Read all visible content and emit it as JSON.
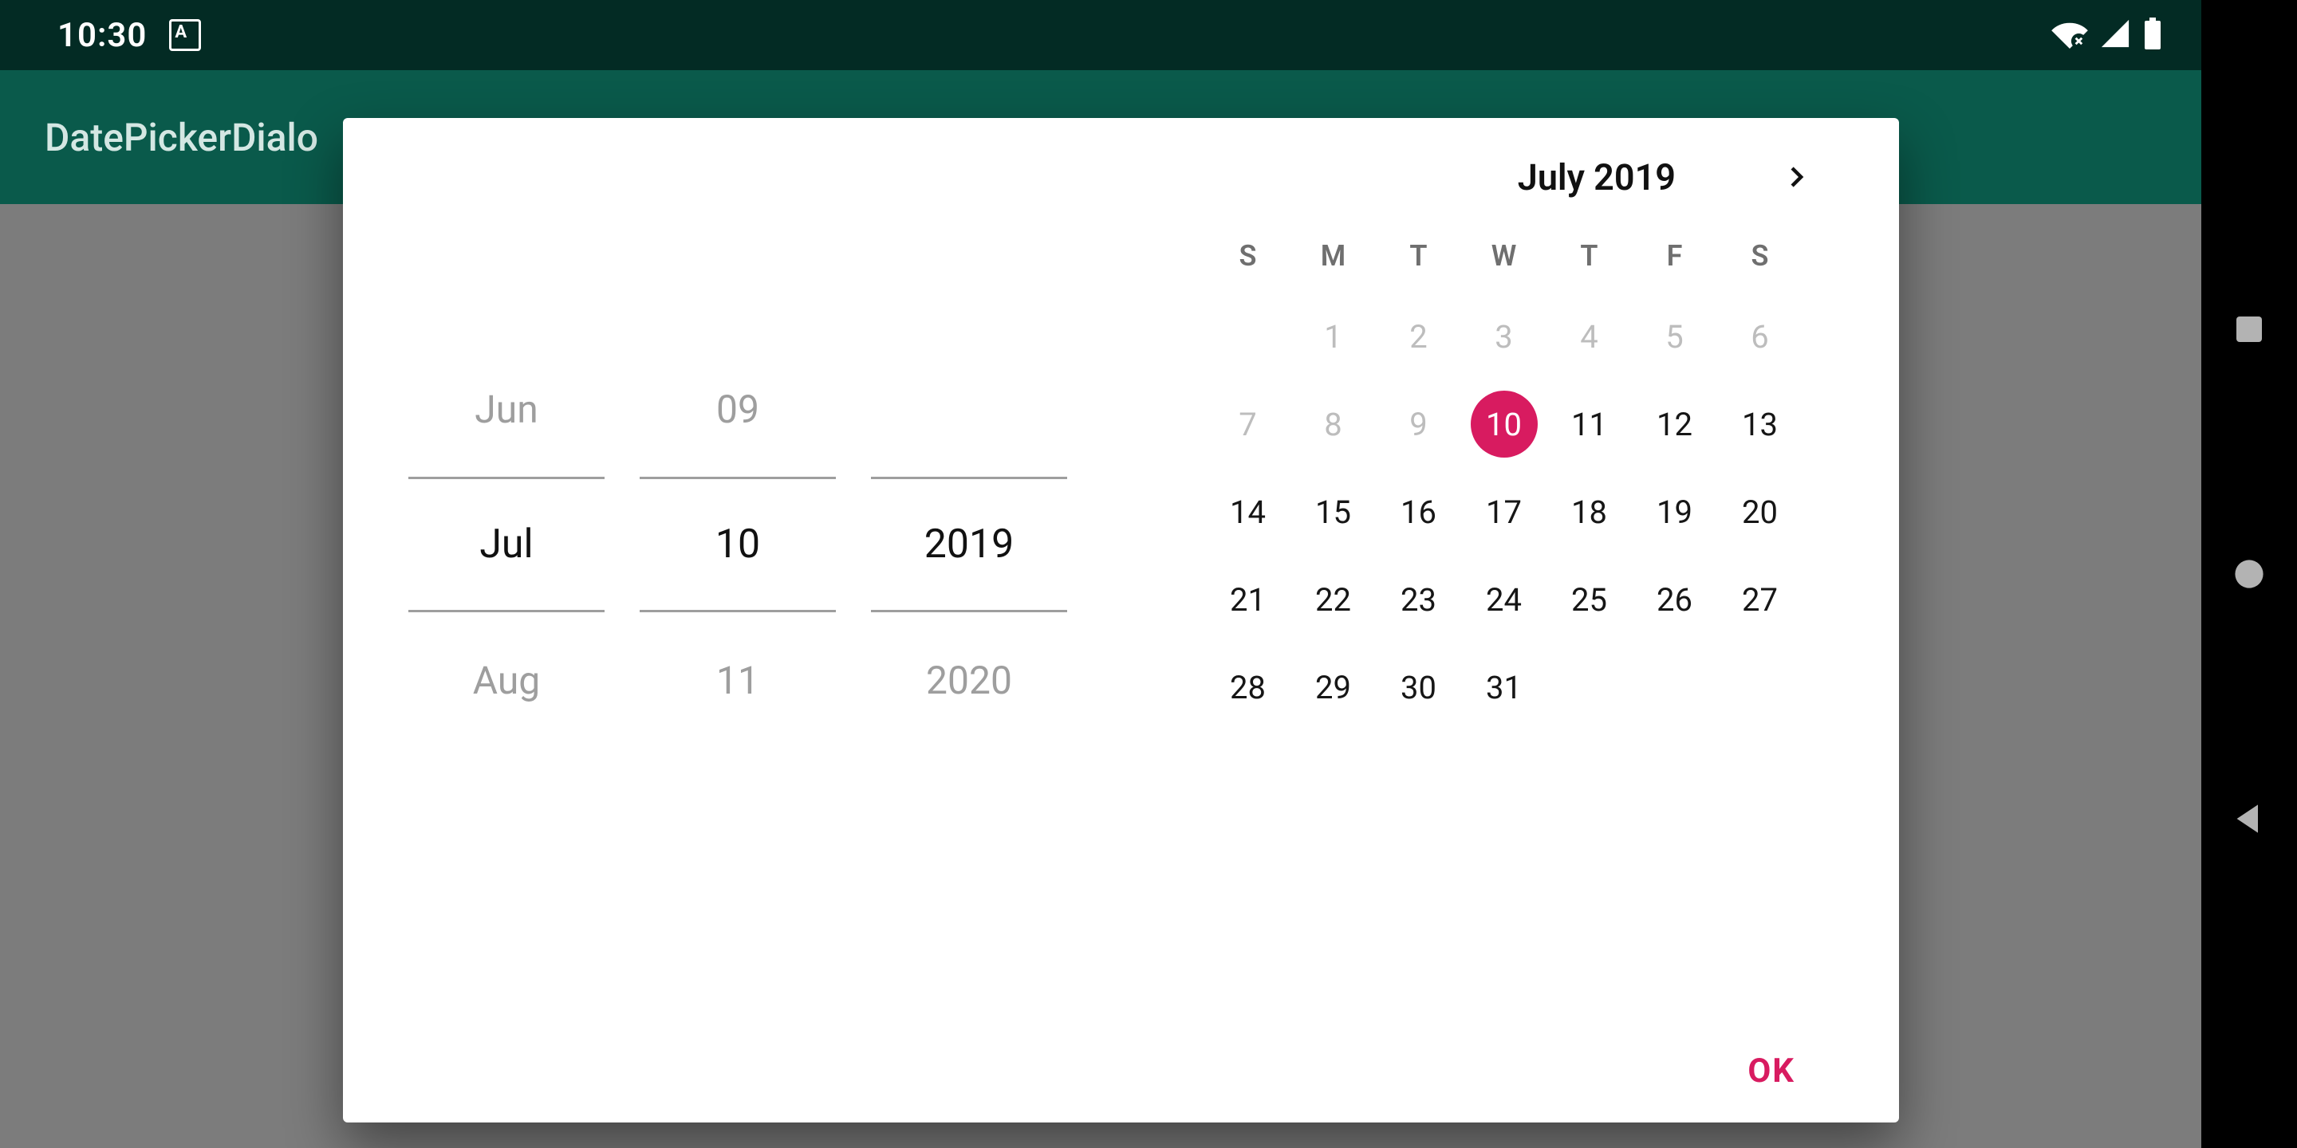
{
  "status": {
    "time": "10:30"
  },
  "app": {
    "title": "DatePickerDialo"
  },
  "spinner": {
    "month": {
      "prev": "Jun",
      "current": "Jul",
      "next": "Aug"
    },
    "day": {
      "prev": "09",
      "current": "10",
      "next": "11"
    },
    "year": {
      "prev": "",
      "current": "2019",
      "next": "2020"
    }
  },
  "calendar": {
    "month_label": "July 2019",
    "dow": [
      "S",
      "M",
      "T",
      "W",
      "T",
      "F",
      "S"
    ],
    "leading_blanks": 1,
    "disabled_through": 9,
    "selected": 10,
    "days_in_month": 31
  },
  "actions": {
    "ok": "OK"
  },
  "colors": {
    "accent": "#d81b60",
    "appbar": "#0a5a4b",
    "statusbar": "#032b24"
  }
}
